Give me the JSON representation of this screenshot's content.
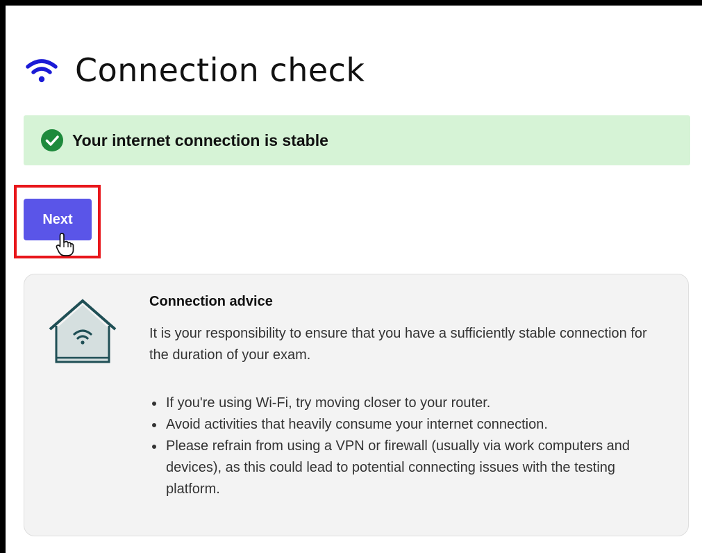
{
  "header": {
    "title": "Connection check",
    "icon": "wifi-icon"
  },
  "status": {
    "message": "Your internet connection is stable",
    "icon": "check-circle-icon",
    "state": "success"
  },
  "actions": {
    "next_label": "Next"
  },
  "advice": {
    "title": "Connection advice",
    "body": "It is your responsibility to ensure that you have a sufficiently stable connection for the duration of your exam.",
    "tips": [
      "If you're using Wi-Fi, try moving closer to your router.",
      "Avoid activities that heavily consume your internet connection.",
      "Please refrain from using a VPN or firewall (usually via work computers and devices), as this could lead to potential connecting issues with the testing platform."
    ],
    "icon": "house-wifi-icon"
  },
  "colors": {
    "accent": "#5a55e8",
    "success_bg": "#d6f3d6",
    "success": "#1e8a3c",
    "highlight": "#e8161b",
    "icon_teal": "#1f4f55"
  }
}
